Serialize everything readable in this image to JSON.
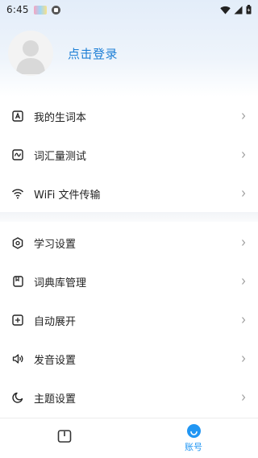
{
  "status_bar": {
    "time": "6:45"
  },
  "profile": {
    "login_label": "点击登录"
  },
  "menu_group_1": [
    {
      "label": "我的生词本",
      "icon": "a-box-icon"
    },
    {
      "label": "词汇量测试",
      "icon": "wave-box-icon"
    },
    {
      "label": "WiFi 文件传输",
      "icon": "wifi-icon"
    }
  ],
  "menu_group_2": [
    {
      "label": "学习设置",
      "icon": "hexagon-icon"
    },
    {
      "label": "词典库管理",
      "icon": "book-box-icon"
    },
    {
      "label": "自动展开",
      "icon": "plus-box-icon"
    },
    {
      "label": "发音设置",
      "icon": "speaker-icon"
    },
    {
      "label": "主题设置",
      "icon": "moon-icon"
    }
  ],
  "bottom_nav": {
    "account_label": "账号"
  },
  "colors": {
    "accent": "#2196f3",
    "login_text": "#1e7fd6"
  }
}
